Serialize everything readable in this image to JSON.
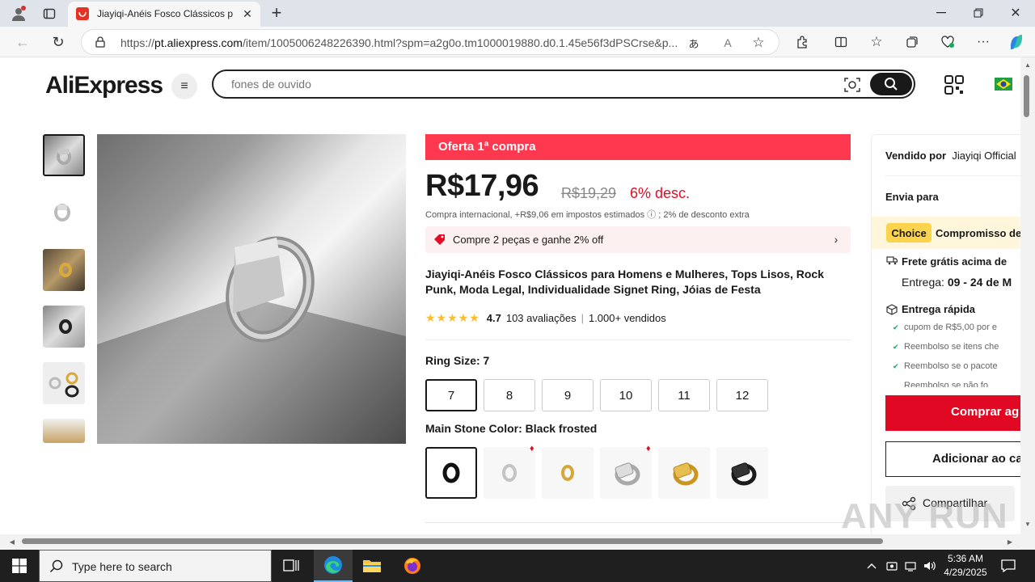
{
  "browser": {
    "tab_title": "Jiayiqi-Anéis Fosco Clássicos par",
    "url_prefix": "https://",
    "url_host": "pt.aliexpress.com",
    "url_path": "/item/1005006248226390.html?spm=a2g0o.tm1000019880.d0.1.45e56f3dPSCrse&p...",
    "colors": {
      "tabbar": "#dfe4ea",
      "addrbar": "#f7f7f7"
    }
  },
  "header": {
    "logo": "AliExpress",
    "search_placeholder": "fones de ouvido",
    "flag": "brazil-flag-icon"
  },
  "gallery": {
    "thumbnails": [
      "silver-ring-shadow",
      "silver-ring-white",
      "gold-ring-pair",
      "black-ring-pair",
      "multi-color-rings",
      "gold-rings-partial"
    ],
    "selected_index": 0
  },
  "product": {
    "promo_banner": "Oferta 1ª compra",
    "price": "R$17,96",
    "old_price": "R$19,29",
    "discount": "6% desc.",
    "tax_note": "Compra internacional, +R$9,06 em impostos estimados ⓘ ; 2% de desconto extra",
    "bundle_offer": "Compre 2 peças e ganhe 2% off",
    "title": "Jiayiqi-Anéis Fosco Clássicos para Homens e Mulheres, Tops Lisos, Rock Punk, Moda Legal, Individualidade Signet Ring, Jóias de Festa",
    "rating": "4.7",
    "reviews": "103 avaliações",
    "sold": "1.000+ vendidos",
    "star_count": 4.7,
    "ring_size_label": "Ring Size: 7",
    "sizes": [
      "7",
      "8",
      "9",
      "10",
      "11",
      "12"
    ],
    "selected_size": "7",
    "color_label": "Main Stone Color: Black frosted",
    "color_options": [
      "black-frosted",
      "silver-round",
      "gold-round",
      "silver-square",
      "gold-square",
      "black-square"
    ],
    "selected_color": "black-frosted",
    "accent": "#fd384f"
  },
  "side_panel": {
    "sold_by_label": "Vendido por",
    "seller": "Jiayiqi Official",
    "ship_to_label": "Envia para",
    "choice_badge": "Choice",
    "choice_text": "Compromisso de",
    "free_shipping": "Frete grátis acima de",
    "delivery_label": "Entrega:",
    "delivery_dates": "09 - 24 de M",
    "fast_delivery": "Entrega rápida",
    "benefits": [
      "cupom de R$5,00 por e",
      "Reembolso se itens che",
      "Reembolso se o pacote",
      "Reembolso se não fo"
    ],
    "buy_now": "Comprar ag",
    "add_to_cart": "Adicionar ao ca",
    "share": "Compartilhar",
    "buy_color": "#e00822"
  },
  "taskbar": {
    "search_placeholder": "Type here to search",
    "time": "5:36 AM",
    "date": "4/29/2025"
  },
  "watermark": "ANY RUN"
}
